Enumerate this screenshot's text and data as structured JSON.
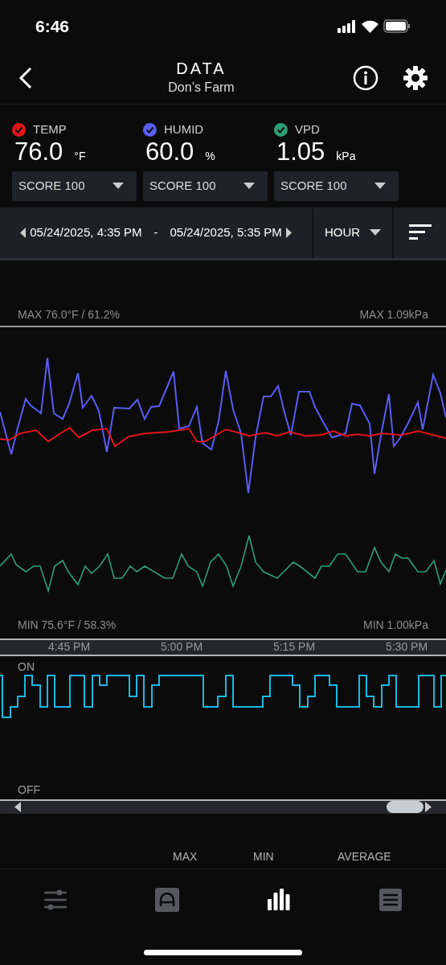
{
  "status_bar": {
    "time": "6:46"
  },
  "header": {
    "title": "DATA",
    "subtitle": "Don’s Farm"
  },
  "sensors": [
    {
      "name": "TEMP",
      "value": "76.0",
      "unit": "°F",
      "checked": true,
      "color": "#e0141e",
      "score": "SCORE 100"
    },
    {
      "name": "HUMID",
      "value": "60.0",
      "unit": "%",
      "checked": true,
      "color": "#5b5cf0",
      "score": "SCORE 100"
    },
    {
      "name": "VPD",
      "value": "1.05",
      "unit": "kPa",
      "checked": true,
      "color": "#2e9e74",
      "score": "SCORE 100"
    }
  ],
  "range": {
    "start": "05/24/2025, 4:35 PM",
    "separator": "-",
    "end": "05/24/2025, 5:35 PM",
    "interval": "HOUR"
  },
  "chart": {
    "max_left": "MAX 76.0°F / 61.2%",
    "max_right": "MAX 1.09kPa",
    "min_left": "MIN 75.6°F / 58.3%",
    "min_right": "MIN 1.00kPa",
    "time_labels": [
      "4:45 PM",
      "5:00 PM",
      "5:15 PM",
      "5:30 PM"
    ]
  },
  "switch_chart": {
    "on_label": "ON",
    "off_label": "OFF"
  },
  "summary_columns": [
    "MAX",
    "MIN",
    "AVERAGE"
  ],
  "tabs": [
    {
      "kind": "sliders",
      "selected": false
    },
    {
      "kind": "arch",
      "selected": false
    },
    {
      "kind": "bars",
      "selected": true
    },
    {
      "kind": "list",
      "selected": false
    }
  ]
}
